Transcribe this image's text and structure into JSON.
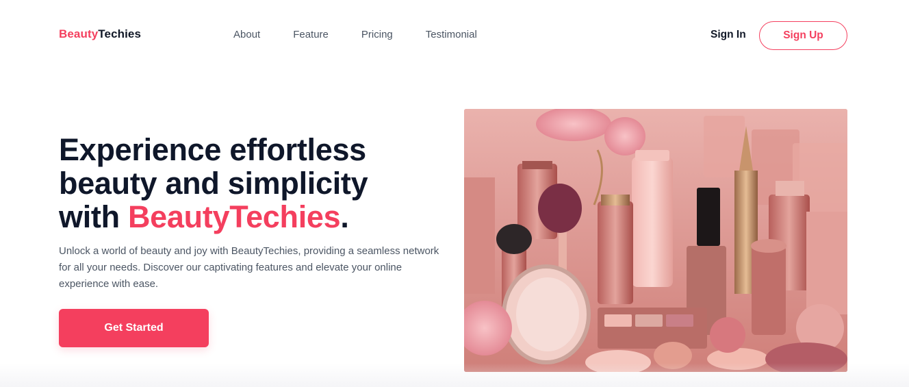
{
  "brand": {
    "accent": "Beauty",
    "rest": "Techies"
  },
  "nav": {
    "items": [
      {
        "label": "About"
      },
      {
        "label": "Feature"
      },
      {
        "label": "Pricing"
      },
      {
        "label": "Testimonial"
      }
    ],
    "sign_in": "Sign In",
    "sign_up": "Sign Up"
  },
  "hero": {
    "title_line1": "Experience effortless",
    "title_line2": "beauty and simplicity",
    "title_line3_prefix": "with ",
    "title_brand": "BeautyTechies",
    "title_suffix": ".",
    "description": "Unlock a world of beauty and joy with BeautyTechies, providing a seamless network for all your needs. Discover our captivating features and elevate your online experience with ease.",
    "cta_label": "Get Started",
    "image_alt": "cosmetics-product-photo"
  },
  "colors": {
    "accent": "#f43f5e",
    "heading": "#0f172a",
    "body_text": "#4b5563"
  }
}
